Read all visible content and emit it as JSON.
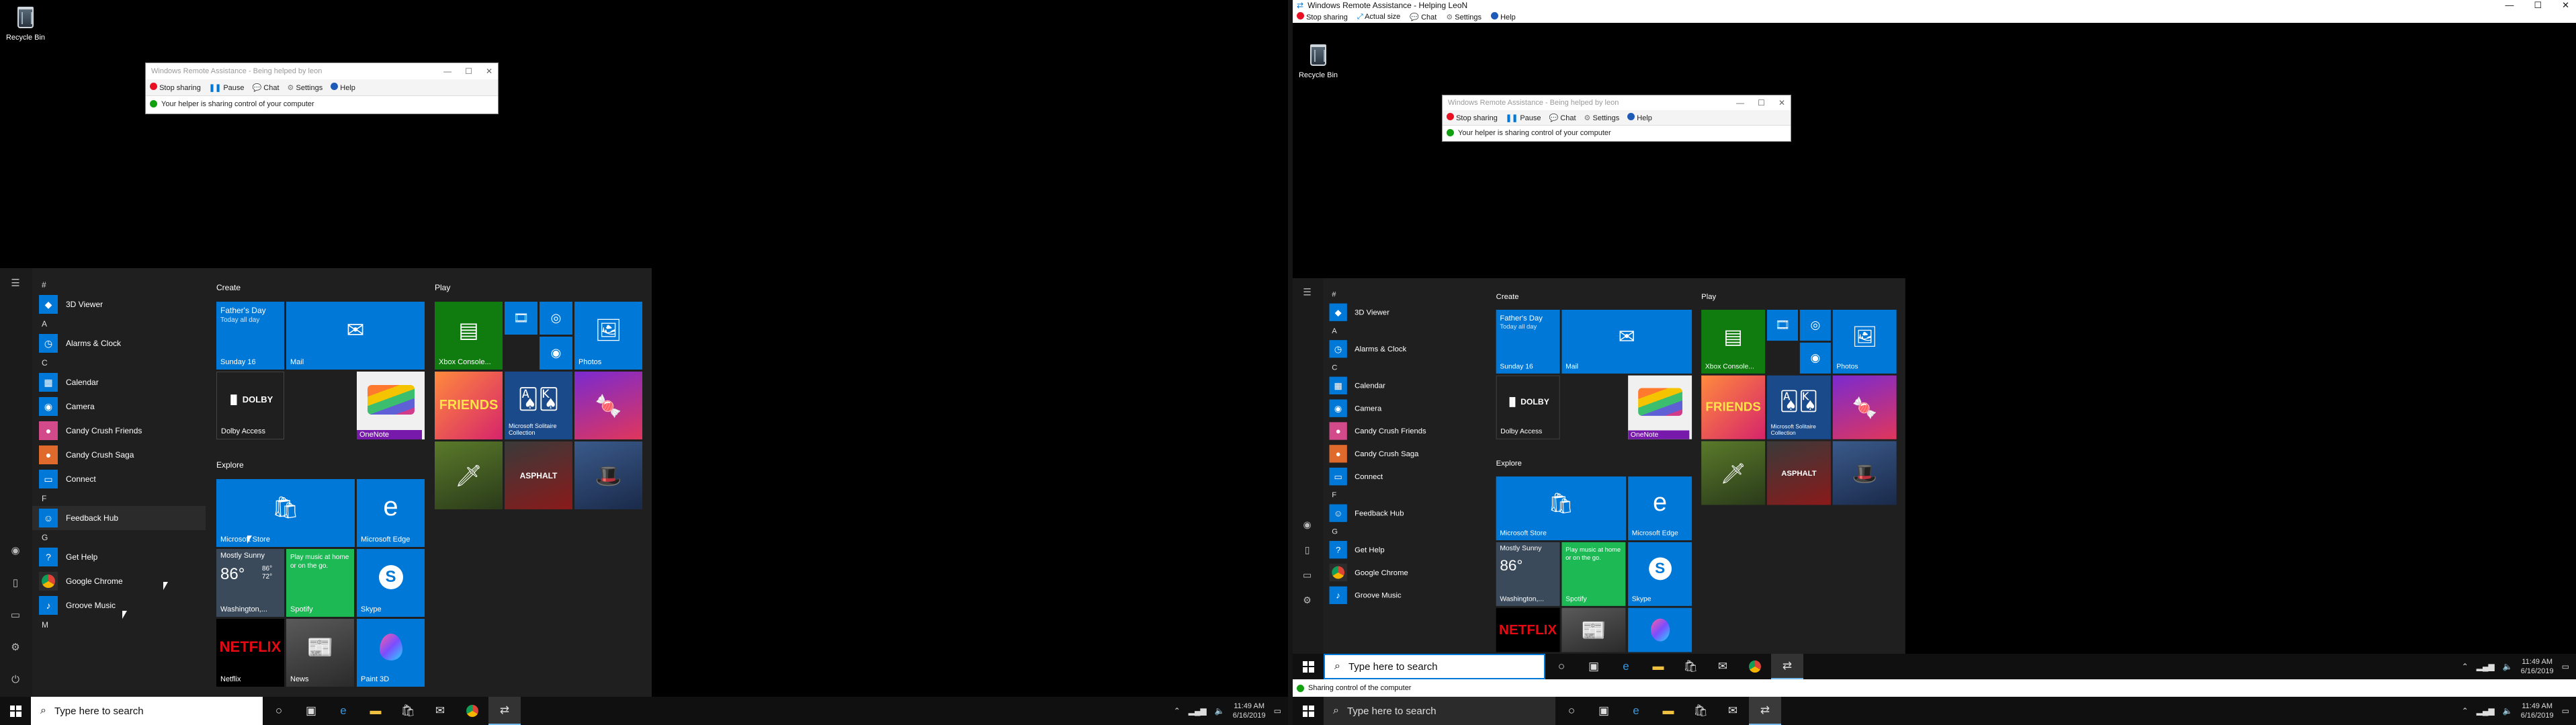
{
  "desktop": {
    "recycle_bin": "Recycle Bin"
  },
  "ra_dialog_left": {
    "title": "Windows Remote Assistance - Being helped by leon",
    "toolbar": [
      "Stop sharing",
      "Pause",
      "Chat",
      "Settings",
      "Help"
    ],
    "status": "Your helper is sharing control of your computer"
  },
  "ra_window": {
    "title": "Windows Remote Assistance - Helping LeoN",
    "toolbar": [
      "Stop sharing",
      "Actual size",
      "Chat",
      "Settings",
      "Help"
    ],
    "statusbar": "Sharing control of the computer"
  },
  "ra_dialog_right": {
    "title": "Windows Remote Assistance - Being helped by leon",
    "toolbar": [
      "Stop sharing",
      "Pause",
      "Chat",
      "Settings",
      "Help"
    ],
    "status": "Your helper is sharing control of your computer"
  },
  "start_menu": {
    "headers": [
      "#",
      "A",
      "C",
      "F",
      "G",
      "M"
    ],
    "apps": [
      "3D Viewer",
      "Alarms & Clock",
      "Calendar",
      "Camera",
      "Candy Crush Friends",
      "Candy Crush Saga",
      "Connect",
      "Feedback Hub",
      "Get Help",
      "Google Chrome",
      "Groove Music"
    ],
    "groups": [
      "Create",
      "Play",
      "Explore"
    ],
    "tiles": {
      "fathers_day": "Father's Day",
      "fathers_day_sub": "Today all day",
      "sunday": "Sunday 16",
      "mail": "Mail",
      "dolby": "Dolby Access",
      "onenote": "OneNote",
      "xbox": "Xbox Console...",
      "photos": "Photos",
      "solitaire": "Microsoft Solitaire Collection",
      "store": "Microsoft Store",
      "edge": "Microsoft Edge",
      "weather_cond": "Mostly Sunny",
      "weather_temp": "86°",
      "weather_hi": "86°",
      "weather_lo": "72°",
      "weather_city": "Washington,...",
      "spotify_msg": "Play music at home or on the go.",
      "spotify": "Spotify",
      "skype": "Skype",
      "netflix": "Netflix",
      "netflix_logo": "NETFLIX",
      "news": "News",
      "paint3d": "Paint 3D"
    }
  },
  "taskbar": {
    "search_placeholder": "Type here to search",
    "time": "11:49 AM",
    "date": "6/16/2019"
  },
  "colors": {
    "accent": "#0078d7",
    "spotify": "#1db954",
    "dolby": "#1a1a1a",
    "netflix": "#000000"
  }
}
